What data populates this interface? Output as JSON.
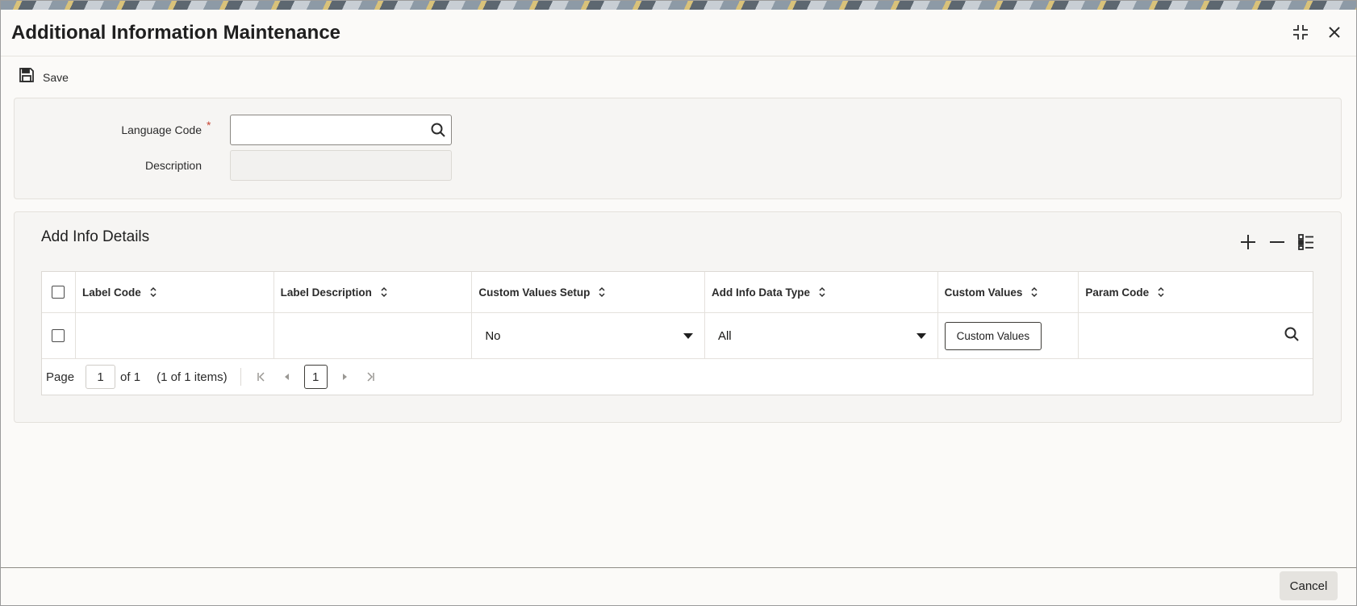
{
  "window": {
    "title": "Additional Information Maintenance"
  },
  "toolbar": {
    "save_label": "Save"
  },
  "header_form": {
    "language_code_label": "Language Code",
    "required_marker": "*",
    "language_code_value": "",
    "description_label": "Description",
    "description_value": ""
  },
  "add_info": {
    "section_title": "Add Info Details",
    "columns": [
      "Label Code",
      "Label Description",
      "Custom Values Setup",
      "Add Info Data Type",
      "Custom Values",
      "Param Code"
    ],
    "rows": [
      {
        "label_code": "",
        "label_description": "",
        "custom_values_setup": "No",
        "add_info_data_type": "All",
        "custom_values_button": "Custom Values",
        "param_code": ""
      }
    ],
    "pagination": {
      "page_label": "Page",
      "page_value": "1",
      "of_text": "of 1",
      "items_text": "(1 of 1 items)",
      "current_page": "1"
    }
  },
  "footer": {
    "cancel_label": "Cancel"
  },
  "colors": {
    "required": "#c74634",
    "background": "#fbfaf8",
    "panel": "#f6f5f3"
  }
}
